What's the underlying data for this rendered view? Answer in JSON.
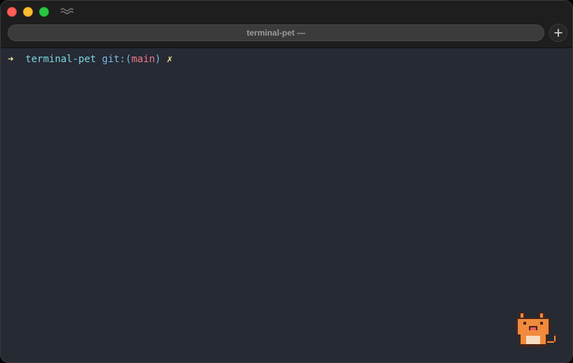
{
  "window": {
    "tab_title": "terminal-pet —"
  },
  "icons": {
    "wave": "wave-icon",
    "plus": "plus-icon",
    "pet": "cat-pet-icon"
  },
  "colors": {
    "background": "#262a33",
    "prompt_arrow": "#f0e6a0",
    "directory": "#7ad6e0",
    "git_label": "#7ab8e8",
    "branch": "#f07a8a",
    "cat_orange": "#f08a3c"
  },
  "prompt": {
    "arrow": "➜",
    "directory": "terminal-pet",
    "git_prefix": "git:(",
    "branch": "main",
    "git_suffix": ")",
    "dirty_marker": "✗"
  }
}
